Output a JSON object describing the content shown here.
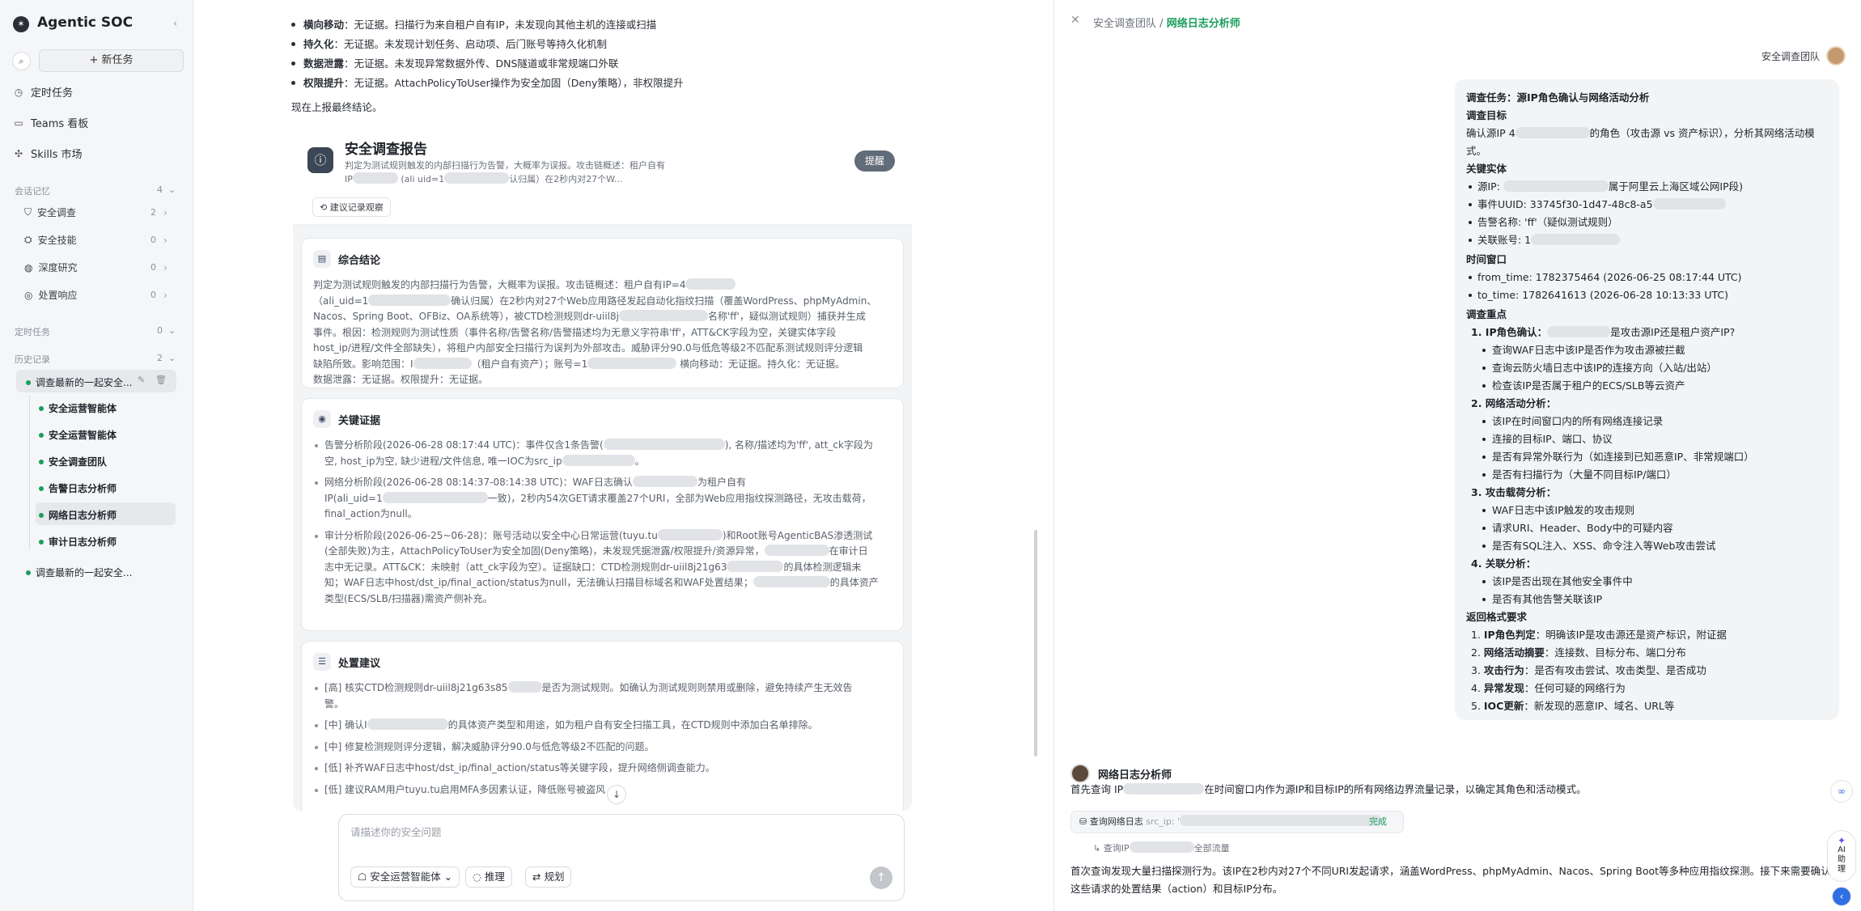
{
  "sidebar": {
    "brand": "Agentic SOC",
    "new_task": "+ 新任务",
    "nav": [
      {
        "icon": "clock-icon",
        "label": "定时任务"
      },
      {
        "icon": "board-icon",
        "label": "Teams 看板"
      },
      {
        "icon": "skills-icon",
        "label": "Skills 市场"
      }
    ],
    "memory_section": {
      "label": "会话记忆",
      "count": "4"
    },
    "memory_items": [
      {
        "label": "安全调查",
        "count": "2"
      },
      {
        "label": "安全技能",
        "count": "0"
      },
      {
        "label": "深度研究",
        "count": "0"
      },
      {
        "label": "处置响应",
        "count": "0"
      }
    ],
    "scheduled_section": {
      "label": "定时任务",
      "count": "0"
    },
    "history_section": {
      "label": "历史记录",
      "count": "2"
    },
    "history_items": [
      {
        "label": "调查最新的一起安全..."
      },
      {
        "label": "调查最新的一起安全..."
      }
    ],
    "tree_items": [
      "安全运营智能体",
      "安全运营智能体",
      "安全调查团队",
      "告警日志分析师",
      "网络日志分析师",
      "审计日志分析师"
    ]
  },
  "main": {
    "top_lines": [
      {
        "key": "横向移动",
        "text": "：无证据。扫描行为来自租户自有IP，未发现向其他主机的连接或扫描"
      },
      {
        "key": "持久化",
        "text": "：无证据。未发现计划任务、启动项、后门账号等持久化机制"
      },
      {
        "key": "数据泄露",
        "text": "：无证据。未发现异常数据外传、DNS隧道或非常规端口外联"
      },
      {
        "key": "权限提升",
        "text": "：无证据。AttachPolicyToUser操作为安全加固（Deny策略），非权限提升"
      }
    ],
    "report_intro": "现在上报最终结论。",
    "report": {
      "title": "安全调查报告",
      "desc_1": "判定为测试规则触发的内部扫描行为告警，大概率为误报。攻击链概述：租户自有",
      "desc_2a": "IP",
      "desc_2b": "(ali uid=1",
      "desc_2c": "认归属）在2秒内对27个W...",
      "remind_button": "提醒",
      "record_link": "建议记录观察",
      "conclusion_title": "综合结论",
      "conclusion_lines": [
        [
          "判定为测试规则触发的内部扫描行为告警，大概率为误报。攻击链概述：租户自有IP=4",
          ""
        ],
        [
          "（ali_uid=1",
          "确认归属）在2秒内对27个Web应用路径发起自动化指纹扫描（覆盖WordPress、phpMyAdmin、"
        ],
        [
          "Nacos、Spring Boot、OFBiz、OA系统等），被CTD检测规则dr-uiil8j",
          "名称'ff'，疑似测试规则）捕获并生成"
        ],
        [
          "事件。根因：检测规则为测试性质（事件名称/告警名称/告警描述均为无意义字符串'ff'，ATT&CK字段为空，关键实体字段",
          ""
        ],
        [
          "host_ip/进程/文件全部缺失），将租户内部安全扫描行为误判为外部攻击。威胁评分90.0与低危等级2不匹配系测试规则评分逻辑",
          ""
        ],
        [
          "缺陷所致。影响范围：I",
          "（租户自有资产）；账号=1",
          "横向移动：无证据。持久化：无证据。"
        ],
        [
          "数据泄露：无证据。权限提升：无证据。",
          ""
        ]
      ],
      "evidence_title": "关键证据",
      "evidence_items": [
        [
          "告警分析阶段(2026-06-28 08:17:44 UTC)：事件仅含1条告警(",
          "), 名称/描述均为'ff', att_ck字段为",
          "空, host_ip为空, 缺少进程/文件信息, 唯一IOC为src_ip",
          "。"
        ],
        [
          "网络分析阶段(2026-06-28 08:14:37-08:14:38 UTC)：WAF日志确认",
          "为租户自有",
          "IP(ali_uid=1",
          "一致)，2秒内54次GET请求覆盖27个URI，全部为Web应用指纹探测路径，无攻击载荷，",
          "final_action为null。"
        ],
        [
          "审计分析阶段(2026-06-25~06-28)：账号活动以安全中心日常运营(tuyu.tu",
          ")和Root账号AgenticBAS渗透测试",
          "(全部失败)为主，AttachPolicyToUser为安全加固(Deny策略)，未发现凭据泄露/权限提升/资源异常，",
          "在审计日",
          "志中无记录。ATT&CK：未映射（att_ck字段为空）。证据缺口：CTD检测规则dr-uiil8j21g63",
          "的具体检测逻辑未",
          "知；WAF日志中host/dst_ip/final_action/status为null，无法确认扫描目标域名和WAF处置结果；",
          "的具体资产",
          "类型(ECS/SLB/扫描器)需资产侧补充。"
        ]
      ],
      "action_title": "处置建议",
      "action_items": [
        [
          "[高] 核实CTD检测规则dr-uiil8j21g63s85",
          "是否为测试规则。如确认为测试规则则禁用或删除，避免持续产生无效告",
          "警。"
        ],
        [
          "[中] 确认I",
          "的具体资产类型和用途，如为租户自有安全扫描工具，在CTD规则中添加白名单排除。"
        ],
        [
          "[中] 修复检测规则评分逻辑，解决威胁评分90.0与低危等级2不匹配的问题。"
        ],
        [
          "[低] 补齐WAF日志中host/dst_ip/final_action/status等关键字段，提升网络侧调查能力。"
        ],
        [
          "[低] 建议RAM用户tuyu.tu启用MFA多因素认证，降低账号被盗风"
        ]
      ]
    },
    "composer": {
      "placeholder": "请描述你的安全问题",
      "agent_chip": "安全运营智能体",
      "reason_chip": "推理",
      "plan_chip": "规划"
    }
  },
  "right": {
    "breadcrumb_parent": "安全调查团队",
    "breadcrumb_sep": "/",
    "breadcrumb_current": "网络日志分析师",
    "user_label": "安全调查团队",
    "task": {
      "title": "调查任务：源IP角色确认与网络活动分析",
      "goal_h": "调查目标",
      "goal_a": "确认源IP 4",
      "goal_b": "的角色（攻击源 vs 资产标识），分析其网络活动模式。",
      "entity_h": "关键实体",
      "entities": [
        [
          "源IP: ",
          "属于阿里云上海区域公网IP段)"
        ],
        [
          "事件UUID: 33745f30-1d47-48c8-a5",
          ""
        ],
        [
          "告警名称: 'ff'（疑似测试规则）",
          ""
        ],
        [
          "关联账号: 1",
          ""
        ]
      ],
      "window_h": "时间窗口",
      "window": [
        "from_time: 1782375464 (2026-06-25 08:17:44 UTC)",
        "to_time: 1782641613 (2026-06-28 10:13:33 UTC)"
      ],
      "focus_h": "调查重点",
      "focus": [
        {
          "title": "1. IP角色确认：",
          "tail": "是攻击源IP还是租户资产IP?",
          "items": [
            "查询WAF日志中该IP是否作为攻击源被拦截",
            "查询云防火墙日志中该IP的连接方向（入站/出站）",
            "检查该IP是否属于租户的ECS/SLB等云资产"
          ]
        },
        {
          "title": "2. 网络活动分析：",
          "tail": "",
          "items": [
            "该IP在时间窗口内的所有网络连接记录",
            "连接的目标IP、端口、协议",
            "是否有异常外联行为（如连接到已知恶意IP、非常规端口）",
            "是否有扫描行为（大量不同目标IP/端口）"
          ]
        },
        {
          "title": "3. 攻击载荷分析：",
          "tail": "",
          "items": [
            "WAF日志中该IP触发的攻击规则",
            "请求URI、Header、Body中的可疑内容",
            "是否有SQL注入、XSS、命令注入等Web攻击尝试"
          ]
        },
        {
          "title": "4. 关联分析：",
          "tail": "",
          "items": [
            "该IP是否出现在其他安全事件中",
            "是否有其他告警关联该IP"
          ]
        }
      ],
      "return_h": "返回格式要求",
      "returns": [
        [
          "1. ",
          "IP角色判定",
          "：明确该IP是攻击源还是资产标识，附证据"
        ],
        [
          "2. ",
          "网络活动摘要",
          "：连接数、目标分布、端口分布"
        ],
        [
          "3. ",
          "攻击行为",
          "：是否有攻击尝试、攻击类型、是否成功"
        ],
        [
          "4. ",
          "异常发现",
          "：任何可疑的网络行为"
        ],
        [
          "5. ",
          "IOC更新",
          "：新发现的恶意IP、域名、URL等"
        ]
      ]
    },
    "agent_name": "网络日志分析师",
    "msg1_a": "首先查询 IP",
    "msg1_b": "在时间窗口内作为源IP和目标IP的所有网络边界流量记录，以确定其角色和活动模式。",
    "tool_label": "查询网络日志",
    "tool_param": "src_ip: '",
    "tool_status": "完成",
    "subquery_a": "查询IP",
    "subquery_b": "全部流量",
    "msg2": "首次查询发现大量扫描探测行为。该IP在2秒内对27个不同URI发起请求，涵盖WordPress、phpMyAdmin、Nacos、Spring Boot等多种应用指纹探测。接下来需要确认这些请求的处置结果（action）和目标IP分布。",
    "ai_assistant": "AI助理"
  }
}
